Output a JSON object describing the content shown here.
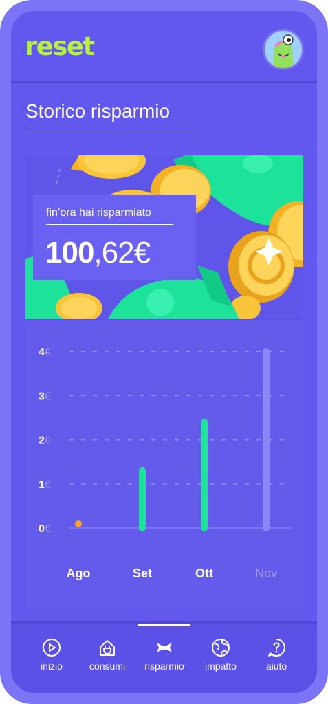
{
  "app": {
    "logo_text": "reset"
  },
  "header": {
    "avatar_icon": "avatar-monster-icon"
  },
  "page": {
    "title": "Storico risparmio"
  },
  "summary": {
    "label": "fin’ora hai risparmiato",
    "amount_integer": "100",
    "amount_decimal": ",62€"
  },
  "chart_data": {
    "type": "bar",
    "categories": [
      "Ago",
      "Set",
      "Ott",
      "Nov"
    ],
    "values": [
      0.0,
      1.3,
      2.4,
      4.0
    ],
    "yticks": [
      "0€",
      "1€",
      "2€",
      "3€",
      "4€"
    ],
    "ylim": [
      0,
      4
    ],
    "grid": true,
    "colors": {
      "bar": "#1de39a",
      "bar_current": "#8c86f5",
      "zero_dot": "#f7a13a",
      "label_dim": "#9e98f7"
    },
    "current_category": "Nov"
  },
  "nav": {
    "items": [
      {
        "label": "inizio",
        "icon": "play-icon"
      },
      {
        "label": "consumi",
        "icon": "house-plug-icon"
      },
      {
        "label": "risparmio",
        "icon": "bow-icon"
      },
      {
        "label": "impatto",
        "icon": "globe-icon"
      },
      {
        "label": "aiuto",
        "icon": "question-bubble-icon"
      }
    ],
    "active_index": 2
  },
  "colors": {
    "brand": "#b6f23a",
    "background": "#6258ee",
    "accent": "#1de39a"
  }
}
